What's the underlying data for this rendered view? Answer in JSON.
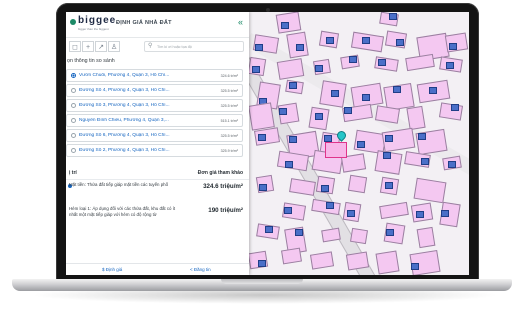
{
  "app": {
    "logo_text": "biggee",
    "logo_tagline": "bigger than the biggest",
    "title": "ĐỊNH GIÁ NHÀ ĐẤT",
    "collapse_glyph": "«"
  },
  "toolbar": {
    "buttons": [
      {
        "icon": "draw-polygon-icon",
        "glyph": "◻"
      },
      {
        "icon": "add-icon",
        "glyph": "+"
      },
      {
        "icon": "trend-icon",
        "glyph": "↗"
      },
      {
        "icon": "user-icon",
        "glyph": "♙"
      }
    ],
    "search_placeholder": "Tìm kí ơi hoặc tọa độ"
  },
  "compare": {
    "heading": "ọn thông tin so sánh",
    "options": [
      {
        "address": "Vườn Chuối, Phường 4, Quận 3, Hồ Chí...",
        "price": "324.6 tr/m²",
        "selected": true
      },
      {
        "address": "Đường Số 4, Phường 4, Quận 3, Hồ Chí...",
        "price": "325.5 tr/m²",
        "selected": false
      },
      {
        "address": "Đường Số 3, Phường 4, Quận 3, Hồ Chí...",
        "price": "325.5 tr/m²",
        "selected": false
      },
      {
        "address": "Nguyễn Đình Chiểu, Phường 4, Quận 3,...",
        "price": "515.1 tr/m²",
        "selected": false
      },
      {
        "address": "Đường Số 6, Phường 4, Quận 3, Hồ Chí...",
        "price": "325.5 tr/m²",
        "selected": false
      },
      {
        "address": "Đường Số 2, Phường 4, Quận 3, Hồ Chí...",
        "price": "325.9 tr/m²",
        "selected": false
      }
    ]
  },
  "table": {
    "col_position": "ị trí",
    "col_price": "Đơn giá tham khảo",
    "rows": [
      {
        "desc": "Mặt tiền: Thửa đất tiếp giáp mặt tiền các tuyến phố",
        "value": "324.6 triệu/m²"
      },
      {
        "desc": "Hẻm loại 1: Áp dụng đối với các thửa đất, khu đất có ít nhất một mặt tiếp giáp với hẻm có độ rộng từ",
        "value": "190 triệu/m²"
      }
    ]
  },
  "actions": {
    "valuate_label": "Định giá",
    "share_label": "Đăng tin"
  },
  "map": {
    "lot_fill": "#f4c8f1",
    "building_fill": "#4a6fc8",
    "pin_color": "#25c5c8"
  }
}
